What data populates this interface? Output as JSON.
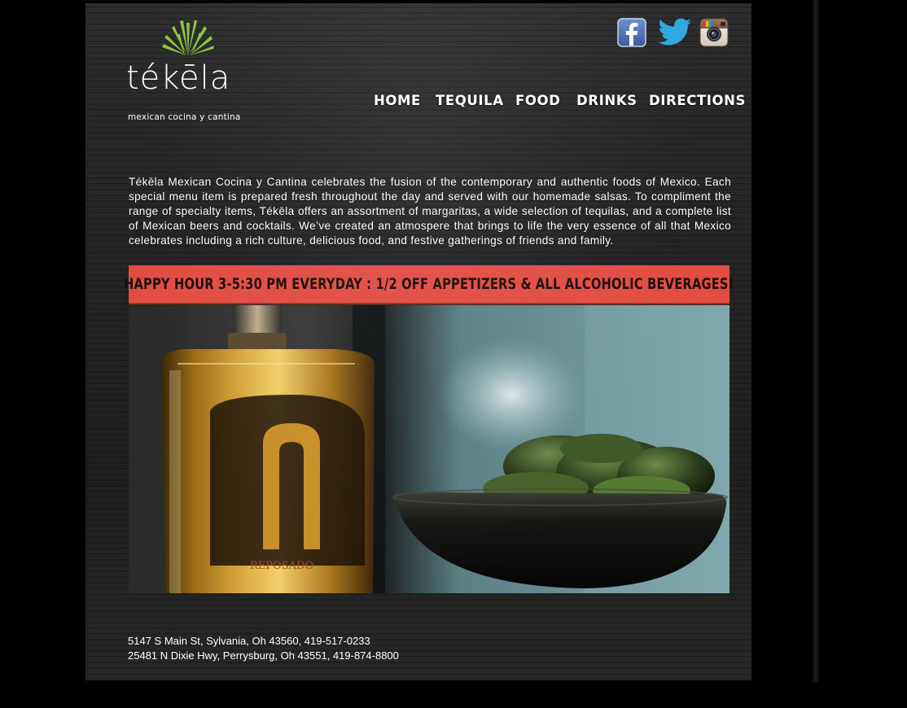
{
  "brand": {
    "name": "tékēla",
    "tagline": "mexican cocina y cantina",
    "accent_green": "#8dc63f"
  },
  "social": [
    {
      "name": "facebook-icon",
      "color": "#3b5998"
    },
    {
      "name": "twitter-icon",
      "color": "#2fa9e0"
    },
    {
      "name": "instagram-icon",
      "color": "#8a6a4f"
    }
  ],
  "nav": {
    "items": [
      "HOME",
      "TEQUILA",
      "FOOD",
      "DRINKS",
      "DIRECTIONS"
    ]
  },
  "intro": {
    "text": "Tékēla Mexican Cocina y Cantina celebrates the fusion of the contemporary and authentic foods of Mexico. Each special menu item is prepared fresh throughout the day and served with our homemade salsas. To compliment the range of specialty items, Tékēla offers an assortment of margaritas, a wide selection of tequilas, and a complete list of Mexican beers and cocktails. We’ve created an atmospere that brings to life the very essence of all that Mexico celebrates including a rich culture, delicious food, and festive gatherings of friends and family."
  },
  "banner": {
    "text": "HAPPY HOUR 3-5:30 PM EVERYDAY : 1/2 OFF APPETIZERS & ALL ALCOHOLIC BEVERAGES!",
    "bg_color": "#e14d43"
  },
  "photo": {
    "bottle_label": "REPOSADO"
  },
  "footer": {
    "addresses": [
      "5147 S Main St, Sylvania, Oh 43560, 419-517-0233",
      "25481 N Dixie Hwy, Perrysburg, Oh 43551, 419-874-8800"
    ]
  }
}
